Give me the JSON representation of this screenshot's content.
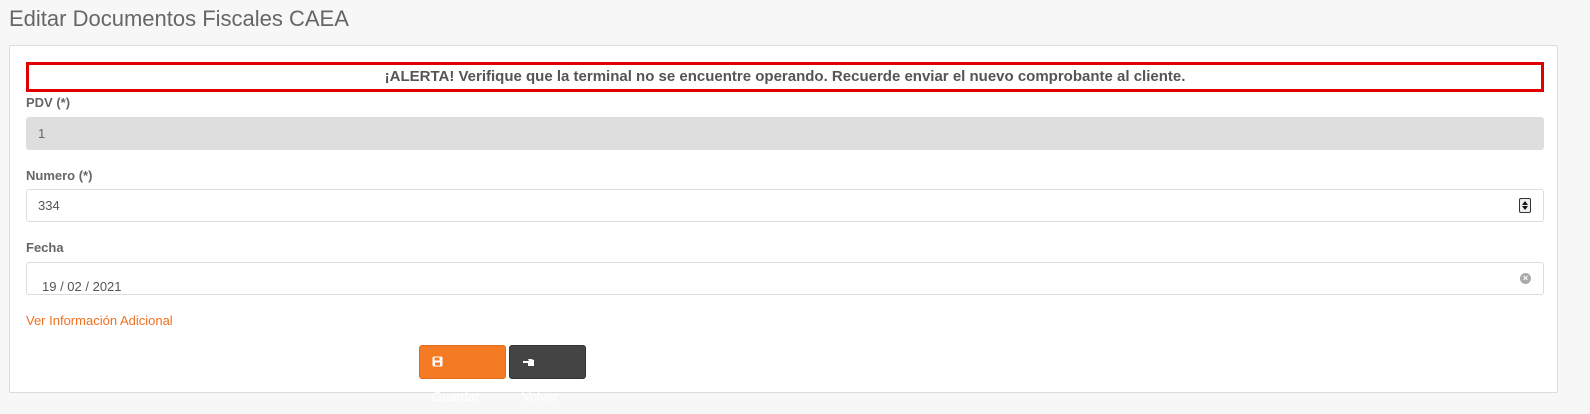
{
  "page": {
    "title": "Editar Documentos Fiscales CAEA"
  },
  "alert": {
    "text": "¡ALERTA! Verifique que la terminal no se encuentre operando. Recuerde enviar el nuevo comprobante al cliente."
  },
  "form": {
    "pdv": {
      "label": "PDV (*)",
      "value": "1"
    },
    "numero": {
      "label": "Numero (*)",
      "value": "334"
    },
    "fecha": {
      "label": "Fecha",
      "value": "19 / 02 / 2021"
    },
    "more_link": "Ver Información Adicional"
  },
  "actions": {
    "save_label": "Guardar",
    "back_label": "Volver",
    "save_icon": "floppy-icon",
    "back_icon": "hand-point-left-icon"
  },
  "colors": {
    "alert_border": "#e00000",
    "accent": "#f47b24",
    "back_button": "#444444"
  }
}
